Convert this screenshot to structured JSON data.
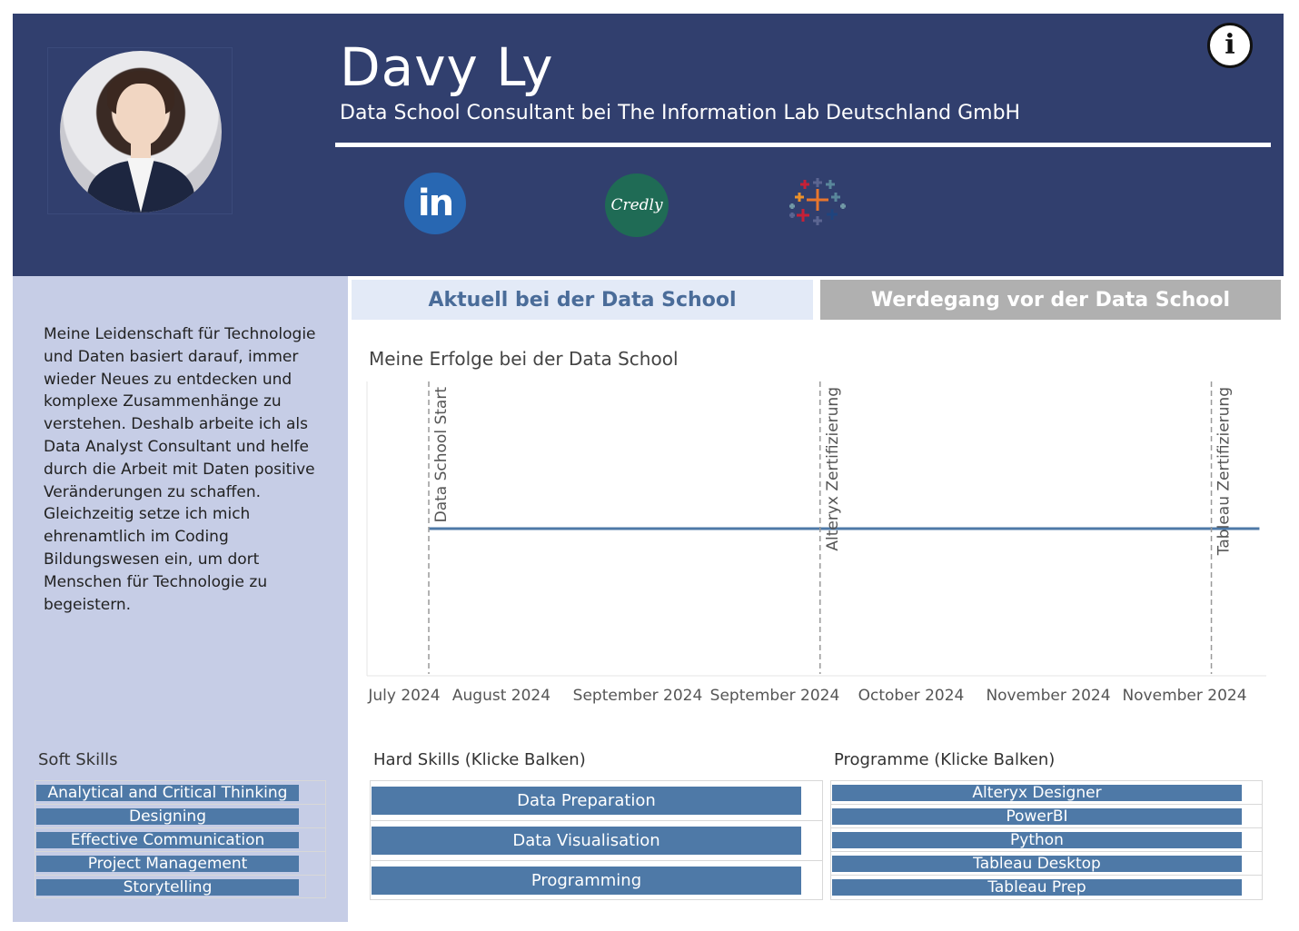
{
  "header": {
    "name": "Davy Ly",
    "subtitle": "Data School Consultant bei The Information Lab Deutschland GmbH",
    "background_color": "#313f6e",
    "info_icon": "info-icon",
    "social_links": [
      {
        "icon": "linkedin-icon",
        "label": "in",
        "color": "#2867b2"
      },
      {
        "icon": "credly-icon",
        "label": "Credly",
        "color": "#1f6b55"
      },
      {
        "icon": "tableau-icon"
      }
    ]
  },
  "sidebar": {
    "background_color": "#c6cde6",
    "bio": "Meine Leidenschaft für Technologie und Daten basiert darauf, immer wieder Neues zu entdecken und komplexe Zusammenhänge zu verstehen. Deshalb arbeite ich als Data Analyst Consultant und helfe durch die Arbeit mit Daten positive Veränderungen zu schaffen. Gleichzeitig setze ich mich ehrenamtlich im Coding Bildungswesen ein, um dort Menschen für Technologie zu begeistern.",
    "soft_skills": {
      "title": "Soft Skills",
      "items": [
        "Analytical and Critical Thinking",
        "Designing",
        "Effective Communication",
        "Project Management",
        "Storytelling"
      ]
    }
  },
  "tabs": [
    {
      "label": "Aktuell bei der Data School",
      "active": true
    },
    {
      "label": "Werdegang vor der Data School",
      "active": false
    }
  ],
  "timeline": {
    "title": "Meine Erfolge bei der Data School"
  },
  "chart_data": {
    "type": "line",
    "title": "Meine Erfolge bei der Data School",
    "xlabel": "",
    "ylabel": "",
    "x_ticks": [
      "July 2024",
      "August 2024",
      "September 2024",
      "September 2024",
      "October 2024",
      "November 2024",
      "November 2024"
    ],
    "x_range": [
      "2024-07-22",
      "2024-11-30"
    ],
    "series": [
      {
        "x": [
          "2024-07-31",
          "2024-11-29"
        ],
        "y": [
          1,
          1
        ],
        "color": "#4e79a7"
      }
    ],
    "events": [
      {
        "date": "2024-07-31",
        "label": "Data School Start"
      },
      {
        "date": "2024-09-26",
        "label": "Alteryx Zertifizierung"
      },
      {
        "date": "2024-11-22",
        "label": "Tableau Zertifizierung"
      }
    ],
    "grid": false
  },
  "hard_skills": {
    "title": "Hard Skills (Klicke Balken)",
    "items": [
      "Data Preparation",
      "Data Visualisation",
      "Programming"
    ]
  },
  "programs": {
    "title": "Programme (Klicke Balken)",
    "items": [
      "Alteryx Designer",
      "PowerBI",
      "Python",
      "Tableau Desktop",
      "Tableau Prep"
    ]
  },
  "colors": {
    "bar": "#4e79a7",
    "tab_active_bg": "#e3eaf7",
    "tab_inactive_bg": "#b0b0b0"
  }
}
